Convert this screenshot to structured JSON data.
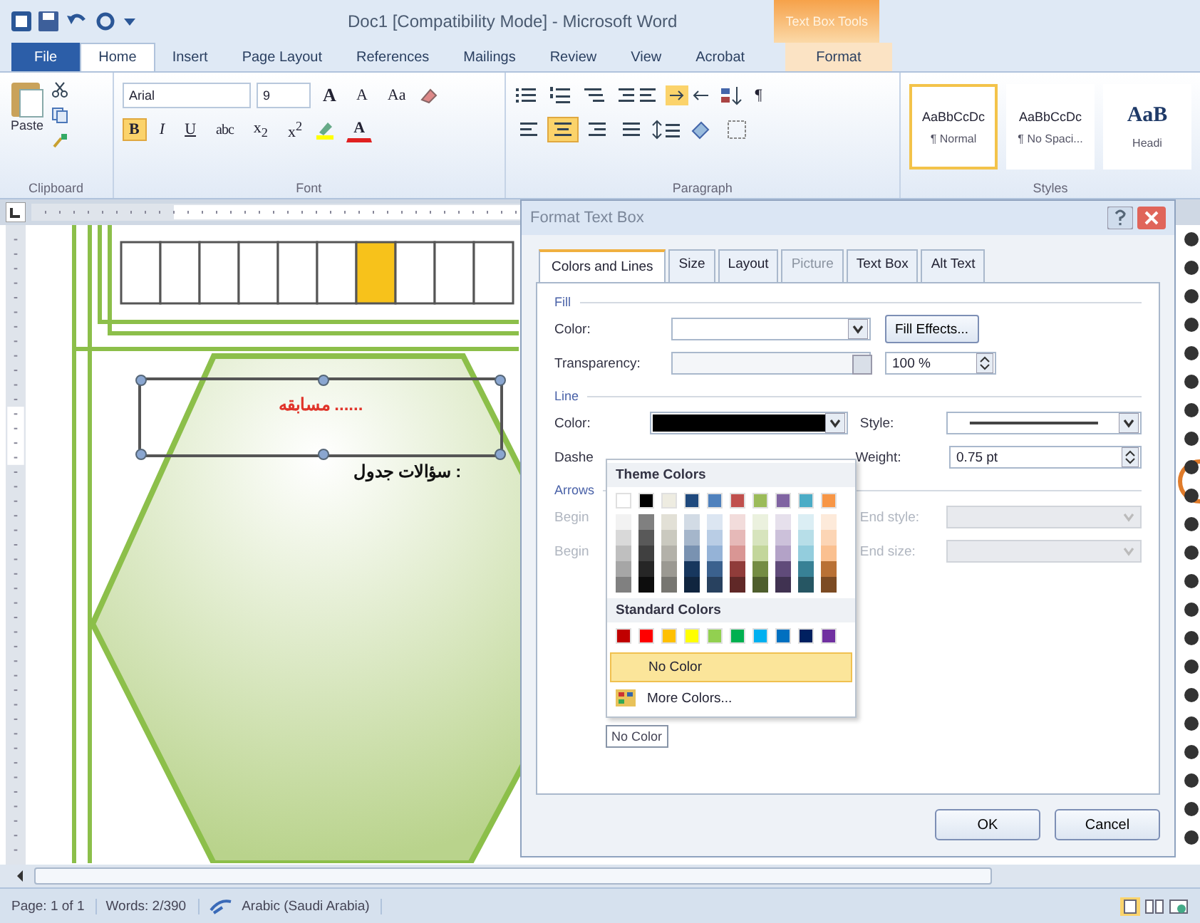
{
  "title_bar": {
    "title": "Doc1 [Compatibility Mode] - Microsoft Word",
    "context_header": "Text Box Tools"
  },
  "tabs": [
    {
      "label": "File",
      "kind": "file",
      "selected": false
    },
    {
      "label": "Home",
      "kind": "normal",
      "selected": true
    },
    {
      "label": "Insert",
      "kind": "normal",
      "selected": false
    },
    {
      "label": "Page Layout",
      "kind": "normal",
      "selected": false
    },
    {
      "label": "References",
      "kind": "normal",
      "selected": false
    },
    {
      "label": "Mailings",
      "kind": "normal",
      "selected": false
    },
    {
      "label": "Review",
      "kind": "normal",
      "selected": false
    },
    {
      "label": "View",
      "kind": "normal",
      "selected": false
    },
    {
      "label": "Acrobat",
      "kind": "normal",
      "selected": false
    },
    {
      "label": "Format",
      "kind": "context",
      "selected": false
    }
  ],
  "ribbon": {
    "clipboard": {
      "paste": "Paste",
      "label": "Clipboard"
    },
    "font": {
      "label": "Font",
      "name": "Arial",
      "size": "9",
      "grow": "A",
      "shrink": "A",
      "case": "Aa",
      "color_letter": "A",
      "styles": [
        {
          "text": "B",
          "kind": "bold",
          "on": true
        },
        {
          "text": "I",
          "kind": "italic",
          "on": false
        },
        {
          "text": "U",
          "kind": "underline",
          "on": false
        },
        {
          "text": "abc",
          "kind": "strike",
          "on": false
        },
        {
          "text": "x$_{2}$",
          "kind": "plain",
          "on": false
        },
        {
          "text": "x$^{2}$",
          "kind": "plain",
          "on": false
        }
      ]
    },
    "paragraph": {
      "label": "Paragraph",
      "pilcrow": "¶",
      "align": [
        {
          "on": false
        },
        {
          "on": true
        },
        {
          "on": false
        },
        {
          "on": false
        }
      ]
    },
    "styles": {
      "label": "Styles",
      "items": [
        {
          "preview": "AaBbCcDc",
          "name": "¶ Normal",
          "kind": "small",
          "selected": true
        },
        {
          "preview": "AaBbCcDc",
          "name": "¶ No Spaci...",
          "kind": "small",
          "selected": false
        },
        {
          "preview": "AaB",
          "name": "Headi",
          "kind": "big",
          "selected": false
        }
      ]
    }
  },
  "document": {
    "cells": [
      {
        "color": "#ffffff"
      },
      {
        "color": "#ffffff"
      },
      {
        "color": "#ffffff"
      },
      {
        "color": "#ffffff"
      },
      {
        "color": "#ffffff"
      },
      {
        "color": "#ffffff"
      },
      {
        "color": "#f7c21b"
      },
      {
        "color": "#ffffff"
      },
      {
        "color": "#ffffff"
      },
      {
        "color": "#ffffff"
      }
    ],
    "textbox_text": "مسابقه ......",
    "caption": "سؤالات جدول :"
  },
  "dialog": {
    "title": "Format Text Box",
    "tabs": [
      {
        "label": "Colors and Lines",
        "selected": true,
        "disabled": false
      },
      {
        "label": "Size",
        "selected": false,
        "disabled": false
      },
      {
        "label": "Layout",
        "selected": false,
        "disabled": false
      },
      {
        "label": "Picture",
        "selected": false,
        "disabled": true
      },
      {
        "label": "Text Box",
        "selected": false,
        "disabled": false
      },
      {
        "label": "Alt Text",
        "selected": false,
        "disabled": false
      }
    ],
    "fill": {
      "heading": "Fill",
      "color_label": "Color:",
      "effects_button": "Fill Effects...",
      "transparency_label": "Transparency:",
      "transparency": {
        "level": 1
      },
      "transparency_value": "100 %"
    },
    "line": {
      "heading": "Line",
      "color_label": "Color:",
      "style_label": "Style:",
      "dashed_label": "Dashe",
      "weight_label": "Weight:",
      "weight_value": "0.75 pt"
    },
    "arrows": {
      "heading": "Arrows",
      "begin_style_label": "Begin",
      "begin_size_label": "Begin",
      "end_style_label": "End style:",
      "end_size_label": "End size:",
      "disabled": true
    },
    "color_menu": {
      "theme_heading": "Theme Colors",
      "theme": [
        {
          "color": "#ffffff"
        },
        {
          "color": "#000000"
        },
        {
          "color": "#eeece1"
        },
        {
          "color": "#1f497d"
        },
        {
          "color": "#4f81bd"
        },
        {
          "color": "#c0504d"
        },
        {
          "color": "#9bbb59"
        },
        {
          "color": "#8064a2"
        },
        {
          "color": "#4bacc6"
        },
        {
          "color": "#f79646"
        }
      ],
      "standard_heading": "Standard Colors",
      "standard": [
        {
          "color": "#c00000"
        },
        {
          "color": "#ff0000"
        },
        {
          "color": "#ffc000"
        },
        {
          "color": "#ffff00"
        },
        {
          "color": "#92d050"
        },
        {
          "color": "#00b050"
        },
        {
          "color": "#00b0f0"
        },
        {
          "color": "#0070c0"
        },
        {
          "color": "#002060"
        },
        {
          "color": "#7030a0"
        }
      ],
      "no_color": "No Color",
      "more_colors": "More Colors...",
      "tooltip": "No Color"
    },
    "buttons": [
      "OK",
      "Cancel"
    ]
  },
  "status_bar": {
    "page": "Page: 1 of 1",
    "words": "Words: 2/390",
    "language": "Arabic (Saudi Arabia)"
  }
}
